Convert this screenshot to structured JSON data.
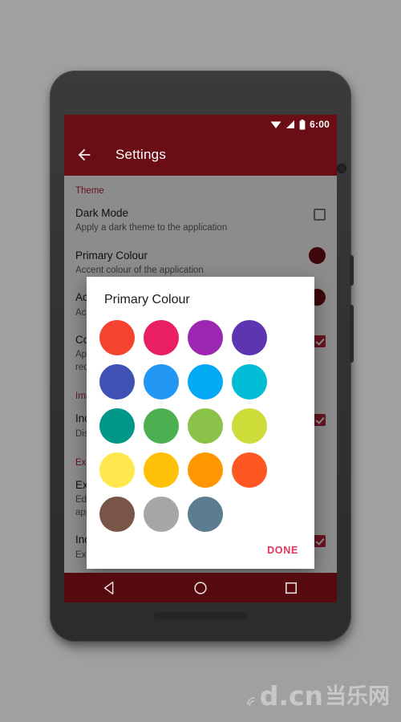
{
  "status_bar": {
    "clock": "6:00",
    "icons": [
      "wifi-icon",
      "signal-icon",
      "battery-icon"
    ]
  },
  "app_bar": {
    "back_icon": "back-arrow-icon",
    "title": "Settings"
  },
  "settings": {
    "sections": [
      {
        "header": "Theme",
        "rows": [
          {
            "title": "Dark Mode",
            "summary": "Apply a dark theme to the application",
            "control": "checkbox",
            "checked": false
          },
          {
            "title": "Primary Colour",
            "summary": "Accent colour of the application",
            "control": "swatch",
            "swatch_color": "#6b0d14"
          },
          {
            "title": "Accent Colour",
            "summary": "Accent colour of the application",
            "control": "swatch",
            "swatch_color": "#6b0d14"
          },
          {
            "title": "Coloured Navigation Bar",
            "summary": "Apply the primary colour to the navigation bar. Restart required.",
            "control": "checkbox",
            "checked": true
          }
        ]
      },
      {
        "header": "Images",
        "rows": [
          {
            "title": "Include Videos",
            "summary": "Display videos in the albums",
            "control": "checkbox",
            "checked": true
          }
        ]
      },
      {
        "header": "Excluded",
        "rows": [
          {
            "title": "Excluded Albums",
            "summary": "Edit the albums that will not be shown in the application.",
            "control": "none"
          },
          {
            "title": "Include Subfolders",
            "summary": "Exclude subfolders of exluded albums",
            "control": "checkbox",
            "checked": true
          }
        ]
      }
    ]
  },
  "dialog": {
    "title": "Primary Colour",
    "done_label": "DONE",
    "done_color": "#e8335c",
    "swatches": [
      {
        "name": "red",
        "hex": "#F4432F"
      },
      {
        "name": "pink",
        "hex": "#E91E63"
      },
      {
        "name": "purple",
        "hex": "#9C27B0"
      },
      {
        "name": "deep-purple",
        "hex": "#5E35B1"
      },
      {
        "name": "indigo",
        "hex": "#3F51B5"
      },
      {
        "name": "blue",
        "hex": "#2196F3"
      },
      {
        "name": "light-blue",
        "hex": "#03A9F4"
      },
      {
        "name": "cyan",
        "hex": "#00BCD4"
      },
      {
        "name": "teal",
        "hex": "#009688"
      },
      {
        "name": "green",
        "hex": "#4CAF50"
      },
      {
        "name": "light-green",
        "hex": "#8BC34A"
      },
      {
        "name": "lime",
        "hex": "#CDDC39"
      },
      {
        "name": "yellow",
        "hex": "#FFE84D"
      },
      {
        "name": "amber",
        "hex": "#FFC107"
      },
      {
        "name": "orange",
        "hex": "#FF9800"
      },
      {
        "name": "deep-orange",
        "hex": "#FF5722"
      },
      {
        "name": "brown",
        "hex": "#795548"
      },
      {
        "name": "grey",
        "hex": "#A6A6A6"
      },
      {
        "name": "blue-grey",
        "hex": "#5C7D8F"
      }
    ]
  },
  "nav_bar": {
    "keys": [
      "back-key-icon",
      "home-key-icon",
      "recents-key-icon"
    ]
  },
  "watermark": {
    "latin": "d.cn",
    "cjk": "当乐网"
  }
}
